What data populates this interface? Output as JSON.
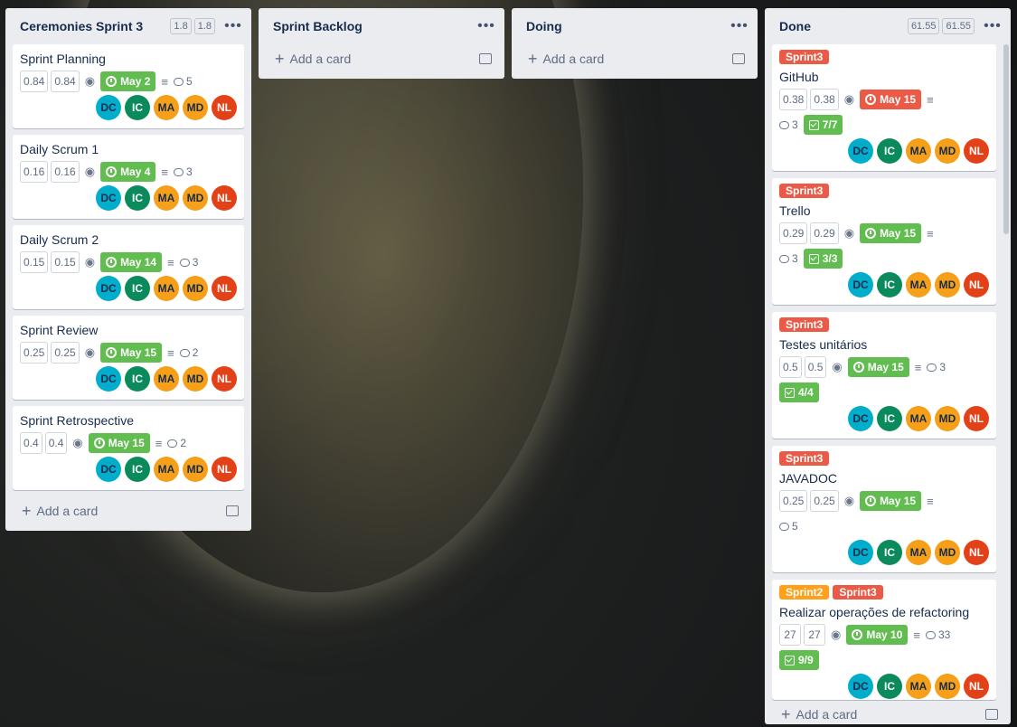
{
  "colors": {
    "green": "#61bd4f",
    "red": "#eb5a46",
    "orange": "#ff9f1a",
    "av_dc": "#00aecc",
    "av_ic": "#0b8a5c",
    "av_ma": "#f6a01a",
    "av_md": "#f6a01a",
    "av_nl": "#e34117"
  },
  "icons": [
    "watch-eye-icon",
    "clock-icon",
    "description-icon",
    "comment-icon",
    "checklist-icon",
    "more-icon",
    "plus-icon",
    "template-icon"
  ],
  "add_card": "Add a card",
  "lists": [
    {
      "title": "Ceremonies Sprint 3",
      "pts": [
        "1.8",
        "1.8"
      ],
      "cards": [
        {
          "title": "Sprint Planning",
          "est": [
            "0.84",
            "0.84"
          ],
          "due": "May 2",
          "comments": "5"
        },
        {
          "title": "Daily Scrum 1",
          "est": [
            "0.16",
            "0.16"
          ],
          "due": "May 4",
          "comments": "3"
        },
        {
          "title": "Daily Scrum 2",
          "est": [
            "0.15",
            "0.15"
          ],
          "due": "May 14",
          "comments": "3"
        },
        {
          "title": "Sprint Review",
          "est": [
            "0.25",
            "0.25"
          ],
          "due": "May 15",
          "comments": "2"
        },
        {
          "title": "Sprint Retrospective",
          "est": [
            "0.4",
            "0.4"
          ],
          "due": "May 15",
          "comments": "2"
        }
      ]
    },
    {
      "title": "Sprint Backlog"
    },
    {
      "title": "Doing"
    },
    {
      "title": "Done",
      "pts": [
        "61.55",
        "61.55"
      ],
      "cards": [
        {
          "labels": [
            "Sprint3"
          ],
          "title": "GitHub",
          "est": [
            "0.38",
            "0.38"
          ],
          "due": "May 15",
          "comments": "3",
          "checklist": "7/7"
        },
        {
          "labels": [
            "Sprint3"
          ],
          "title": "Trello",
          "est": [
            "0.29",
            "0.29"
          ],
          "due": "May 15",
          "comments": "3",
          "checklist": "3/3"
        },
        {
          "labels": [
            "Sprint3"
          ],
          "title": "Testes unitários",
          "est": [
            "0.5",
            "0.5"
          ],
          "due": "May 15",
          "comments": "3",
          "checklist": "4/4"
        },
        {
          "labels": [
            "Sprint3"
          ],
          "title": "JAVADOC",
          "est": [
            "0.25",
            "0.25"
          ],
          "due": "May 15",
          "comments": "5"
        },
        {
          "labels": [
            "Sprint2",
            "Sprint3"
          ],
          "title": "Realizar operações de refactoring",
          "est": [
            "27",
            "27"
          ],
          "due": "May 10",
          "comments": "33",
          "checklist": "9/9"
        }
      ]
    }
  ],
  "members": [
    "DC",
    "IC",
    "MA",
    "MD",
    "NL"
  ]
}
